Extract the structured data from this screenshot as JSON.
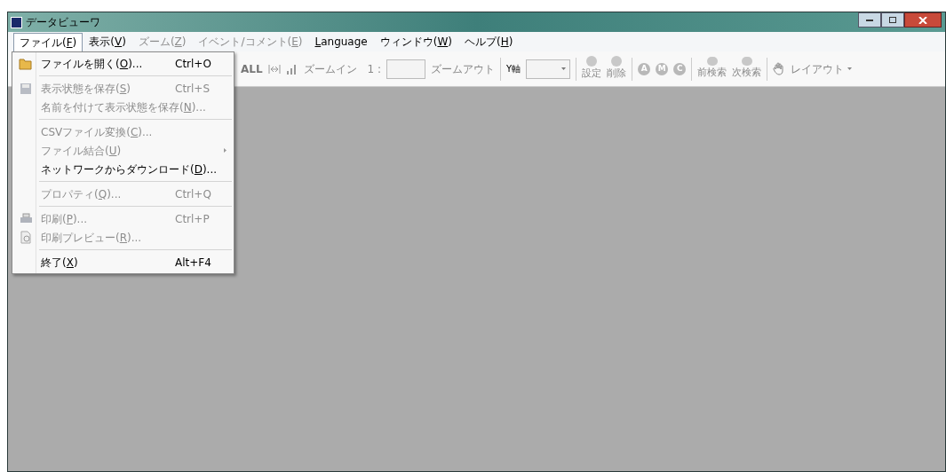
{
  "window": {
    "title": "データビューワ"
  },
  "menubar": [
    {
      "before": "ファイル(",
      "key": "F",
      "after": ")",
      "selected": true,
      "disabled": false
    },
    {
      "before": "表示(",
      "key": "V",
      "after": ")",
      "selected": false,
      "disabled": false
    },
    {
      "before": "ズーム(",
      "key": "Z",
      "after": ")",
      "selected": false,
      "disabled": true
    },
    {
      "before": "イベント/コメント(",
      "key": "E",
      "after": ")",
      "selected": false,
      "disabled": true
    },
    {
      "key": "L",
      "after": "anguage",
      "selected": false,
      "disabled": false
    },
    {
      "before": "ウィンドウ(",
      "key": "W",
      "after": ")",
      "selected": false,
      "disabled": false
    },
    {
      "before": "ヘルプ(",
      "key": "H",
      "after": ")",
      "selected": false,
      "disabled": false
    }
  ],
  "toolbar": {
    "all_label": "ALL",
    "zoom_in": "ズームイン",
    "ratio_label": "1 :",
    "zoom_out": "ズームアウト",
    "y_axis_label": "Y軸",
    "set": "設定",
    "delete": "削除",
    "badges": [
      "A",
      "M",
      "C"
    ],
    "prev_search": "前検索",
    "next_search": "次検索",
    "layout": "レイアウト"
  },
  "file_menu": [
    {
      "kind": "open",
      "before": "ファイルを開く(",
      "key": "O",
      "after": ")...",
      "shortcut": "Ctrl+O",
      "disabled": false
    },
    {
      "kind": "separator"
    },
    {
      "kind": "save",
      "before": "表示状態を保存(",
      "key": "S",
      "after": ")",
      "shortcut": "Ctrl+S",
      "disabled": true
    },
    {
      "kind": "item",
      "before": "名前を付けて表示状態を保存(",
      "key": "N",
      "after": ")...",
      "disabled": true
    },
    {
      "kind": "separator"
    },
    {
      "kind": "item",
      "before": "CSVファイル変換(",
      "key": "C",
      "after": ")...",
      "disabled": true
    },
    {
      "kind": "submenu",
      "before": "ファイル結合(",
      "key": "U",
      "after": ")",
      "disabled": true
    },
    {
      "kind": "item",
      "before": "ネットワークからダウンロード(",
      "key": "D",
      "after": ")...",
      "disabled": false
    },
    {
      "kind": "separator"
    },
    {
      "kind": "item",
      "before": "プロパティ(",
      "key": "Q",
      "after": ")...",
      "shortcut": "Ctrl+Q",
      "disabled": true
    },
    {
      "kind": "separator"
    },
    {
      "kind": "print",
      "before": "印刷(",
      "key": "P",
      "after": ")...",
      "shortcut": "Ctrl+P",
      "disabled": true
    },
    {
      "kind": "preview",
      "before": "印刷プレビュー(",
      "key": "R",
      "after": ")...",
      "disabled": true
    },
    {
      "kind": "separator"
    },
    {
      "kind": "item",
      "before": "終了(",
      "key": "X",
      "after": ")",
      "shortcut": "Alt+F4",
      "disabled": false
    }
  ]
}
